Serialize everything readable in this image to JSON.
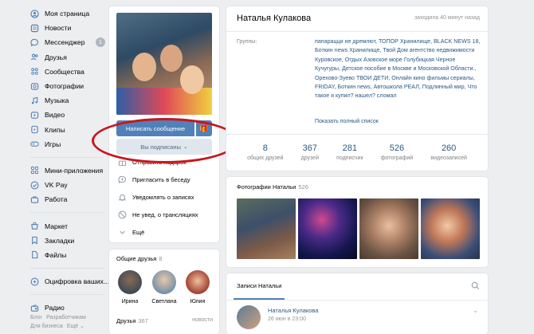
{
  "nav": {
    "items": [
      {
        "label": "Моя страница",
        "icon": "home-icon"
      },
      {
        "label": "Новости",
        "icon": "news-icon"
      },
      {
        "label": "Мессенджер",
        "icon": "messenger-icon",
        "badge": "1"
      },
      {
        "label": "Друзья",
        "icon": "friends-icon"
      },
      {
        "label": "Сообщества",
        "icon": "communities-icon"
      },
      {
        "label": "Фотографии",
        "icon": "photos-icon"
      },
      {
        "label": "Музыка",
        "icon": "music-icon"
      },
      {
        "label": "Видео",
        "icon": "video-icon"
      },
      {
        "label": "Клипы",
        "icon": "clips-icon"
      },
      {
        "label": "Игры",
        "icon": "games-icon"
      }
    ],
    "items2": [
      {
        "label": "Мини-приложения",
        "icon": "apps-icon"
      },
      {
        "label": "VK Pay",
        "icon": "vkpay-icon"
      },
      {
        "label": "Работа",
        "icon": "work-icon"
      }
    ],
    "items3": [
      {
        "label": "Маркет",
        "icon": "market-icon"
      },
      {
        "label": "Закладки",
        "icon": "bookmarks-icon"
      },
      {
        "label": "Файлы",
        "icon": "files-icon"
      }
    ],
    "items4": [
      {
        "label": "Оцифровка ваших...",
        "icon": "digitize-icon"
      }
    ],
    "items5": [
      {
        "label": "Радио",
        "icon": "radio-icon"
      }
    ],
    "footer": {
      "blog": "Блог",
      "devs": "Разработчикам",
      "business": "Для бизнеса",
      "more": "Ещё ⌄"
    }
  },
  "profile": {
    "message_button": "Написать сообщение",
    "subscribed_button": "Вы подписаны",
    "actions": [
      "Отправить подарок",
      "Пригласить в беседу",
      "Уведомлять о записях",
      "Не увед. о трансляциях",
      "Ещё"
    ]
  },
  "friends_block": {
    "title": "Общие друзья",
    "count": "8",
    "friends": [
      "Ирина",
      "Светлана",
      "Юлия"
    ],
    "all_title": "Друзья",
    "all_count": "367",
    "link": "новости"
  },
  "info": {
    "name": "Наталья Кулакова",
    "online": "заходила 40 минут назад",
    "groups_label": "Группы:",
    "groups_text": "папарацци не дремлют, ТОПОР Хранилище, BLACK NEWS 18, Боткин news Хранилище, Твой Дом агентство недвижимости Куровское, Отдых Азовское море Голубицкая Черное Кучугуры, Детское пособие в Москве и Московской Области., Орехово-Зуево ТВОИ ДЕТИ, Онлайн кино фильмы сериалы, FRIDAY, Боткин news, Автошкола РЕАЛ, Подлинный мир, Что такое я купил? нашел? сломал",
    "show_full": "Показать полный список",
    "stats": [
      {
        "num": "8",
        "label": "общих друзей"
      },
      {
        "num": "367",
        "label": "друзей"
      },
      {
        "num": "281",
        "label": "подписчик"
      },
      {
        "num": "526",
        "label": "фотографий"
      },
      {
        "num": "260",
        "label": "видеозаписей"
      }
    ]
  },
  "photos": {
    "title": "Фотографии Натальи",
    "count": "526"
  },
  "posts": {
    "tab": "Записи Натальи",
    "author": "Наталья Кулакова",
    "date": "26 июн в 23:00"
  },
  "colors": {
    "accent": "#5181b8",
    "link": "#2a5885",
    "annotation": "#c8161d"
  }
}
